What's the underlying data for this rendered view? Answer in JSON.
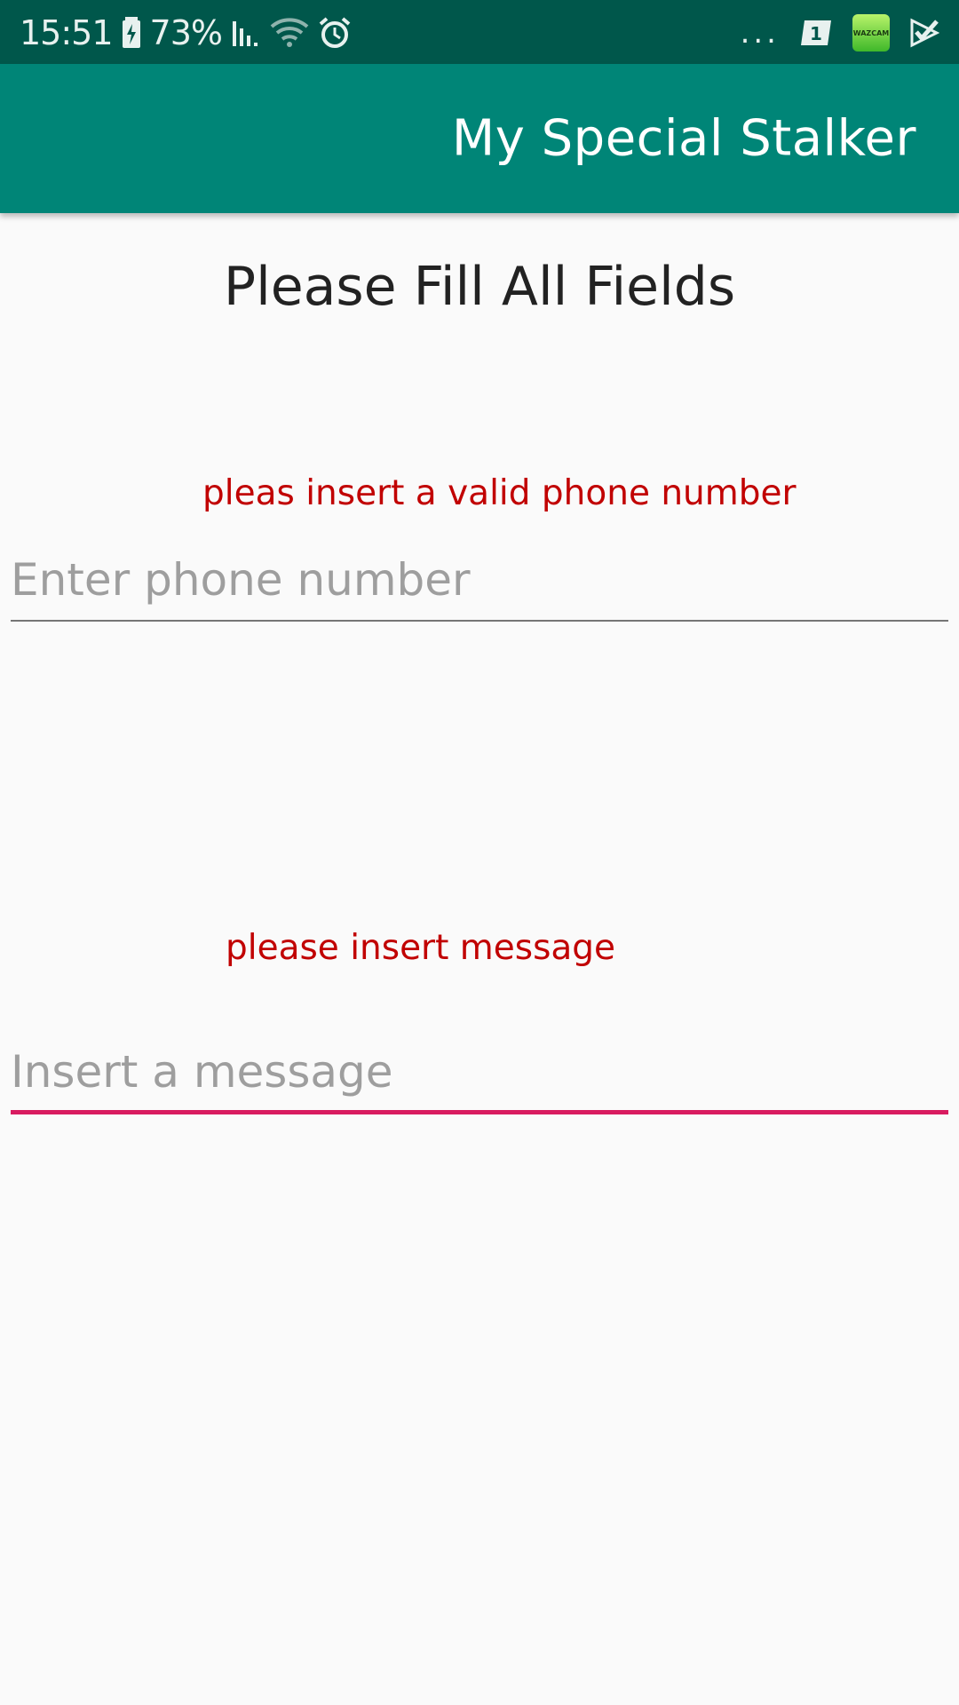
{
  "status_bar": {
    "time": "15:51",
    "battery_percent": "73%",
    "more": "...",
    "icons": [
      "battery-charging-icon",
      "signal-icon",
      "wifi-icon",
      "alarm-icon",
      "notification-1-icon",
      "wazcam-app-icon",
      "check-icon"
    ],
    "wazcam_label": "WAZCAM"
  },
  "app_bar": {
    "title": "My Special Stalker",
    "color": "#008577"
  },
  "form": {
    "heading": "Please Fill All Fields",
    "phone_error": "pleas insert a valid phone number",
    "phone_placeholder": "Enter phone number",
    "message_error": "please insert message",
    "message_placeholder": "Insert a message"
  },
  "colors": {
    "status_bar": "#00574b",
    "error": "#c10000",
    "accent": "#d81b60"
  }
}
